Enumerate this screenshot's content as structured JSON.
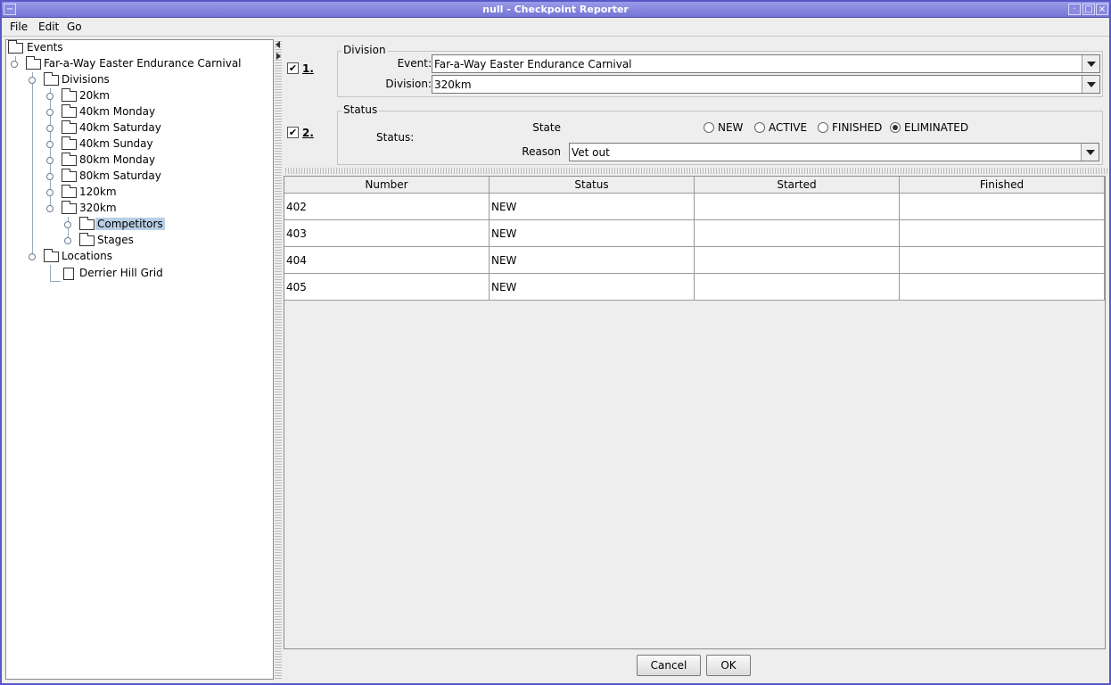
{
  "window": {
    "title": "null - Checkpoint Reporter"
  },
  "menu": {
    "file": "File",
    "edit": "Edit",
    "go": "Go"
  },
  "tree": {
    "root": "Events",
    "event": "Far-a-Way Easter Endurance Carnival",
    "divisions": "Divisions",
    "division_items": [
      "20km",
      "40km Monday",
      "40km Saturday",
      "40km Sunday",
      "80km Monday",
      "80km Saturday",
      "120km",
      "320km"
    ],
    "competitors": "Competitors",
    "stages": "Stages",
    "locations": "Locations",
    "location_item": "Derrier Hill Grid",
    "selected": "Competitors"
  },
  "division_group": {
    "legend": "Division",
    "step_label": "1.",
    "checked": true,
    "event_label": "Event:",
    "event_value": "Far-a-Way Easter Endurance Carnival",
    "division_label": "Division:",
    "division_value": "320km"
  },
  "status_group": {
    "legend": "Status",
    "step_label": "2.",
    "checked": true,
    "status_label": "Status:",
    "state_label": "State",
    "states": [
      "NEW",
      "ACTIVE",
      "FINISHED",
      "ELIMINATED"
    ],
    "selected_state": "ELIMINATED",
    "reason_label": "Reason",
    "reason_value": "Vet out"
  },
  "table": {
    "columns": [
      "Number",
      "Status",
      "Started",
      "Finished"
    ],
    "rows": [
      [
        "402",
        "NEW",
        "",
        ""
      ],
      [
        "403",
        "NEW",
        "",
        ""
      ],
      [
        "404",
        "NEW",
        "",
        ""
      ],
      [
        "405",
        "NEW",
        "",
        ""
      ]
    ]
  },
  "buttons": {
    "cancel": "Cancel",
    "ok": "OK"
  }
}
